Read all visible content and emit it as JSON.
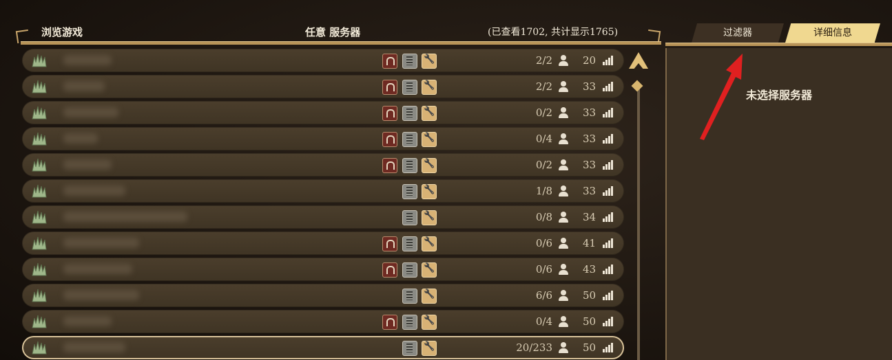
{
  "header": {
    "title": "浏览游戏",
    "filter_label": "任意 服务器",
    "count_text": "(已查看1702, 共计显示1765)"
  },
  "tabs": [
    {
      "label": "过滤器",
      "active": false
    },
    {
      "label": "详细信息",
      "active": true
    }
  ],
  "details": {
    "empty_text": "未选择服务器"
  },
  "servers": [
    {
      "players": "2/2",
      "ping": "20",
      "pvp": true,
      "dedicated": true,
      "mods": true,
      "selected": false
    },
    {
      "players": "2/2",
      "ping": "33",
      "pvp": true,
      "dedicated": true,
      "mods": true,
      "selected": false
    },
    {
      "players": "0/2",
      "ping": "33",
      "pvp": true,
      "dedicated": true,
      "mods": true,
      "selected": false
    },
    {
      "players": "0/4",
      "ping": "33",
      "pvp": true,
      "dedicated": true,
      "mods": true,
      "selected": false
    },
    {
      "players": "0/2",
      "ping": "33",
      "pvp": true,
      "dedicated": true,
      "mods": true,
      "selected": false
    },
    {
      "players": "1/8",
      "ping": "33",
      "pvp": false,
      "dedicated": true,
      "mods": true,
      "selected": false
    },
    {
      "players": "0/8",
      "ping": "34",
      "pvp": false,
      "dedicated": true,
      "mods": true,
      "selected": false
    },
    {
      "players": "0/6",
      "ping": "41",
      "pvp": true,
      "dedicated": true,
      "mods": true,
      "selected": false
    },
    {
      "players": "0/6",
      "ping": "43",
      "pvp": true,
      "dedicated": true,
      "mods": true,
      "selected": false
    },
    {
      "players": "6/6",
      "ping": "50",
      "pvp": false,
      "dedicated": true,
      "mods": true,
      "selected": false
    },
    {
      "players": "0/4",
      "ping": "50",
      "pvp": true,
      "dedicated": true,
      "mods": true,
      "selected": false
    },
    {
      "players": "20/233",
      "ping": "50",
      "pvp": false,
      "dedicated": true,
      "mods": true,
      "selected": true
    }
  ],
  "colors": {
    "accent_gold": "#e2c07a",
    "tab_active": "#f0d890",
    "annotation_arrow": "#e02020"
  }
}
